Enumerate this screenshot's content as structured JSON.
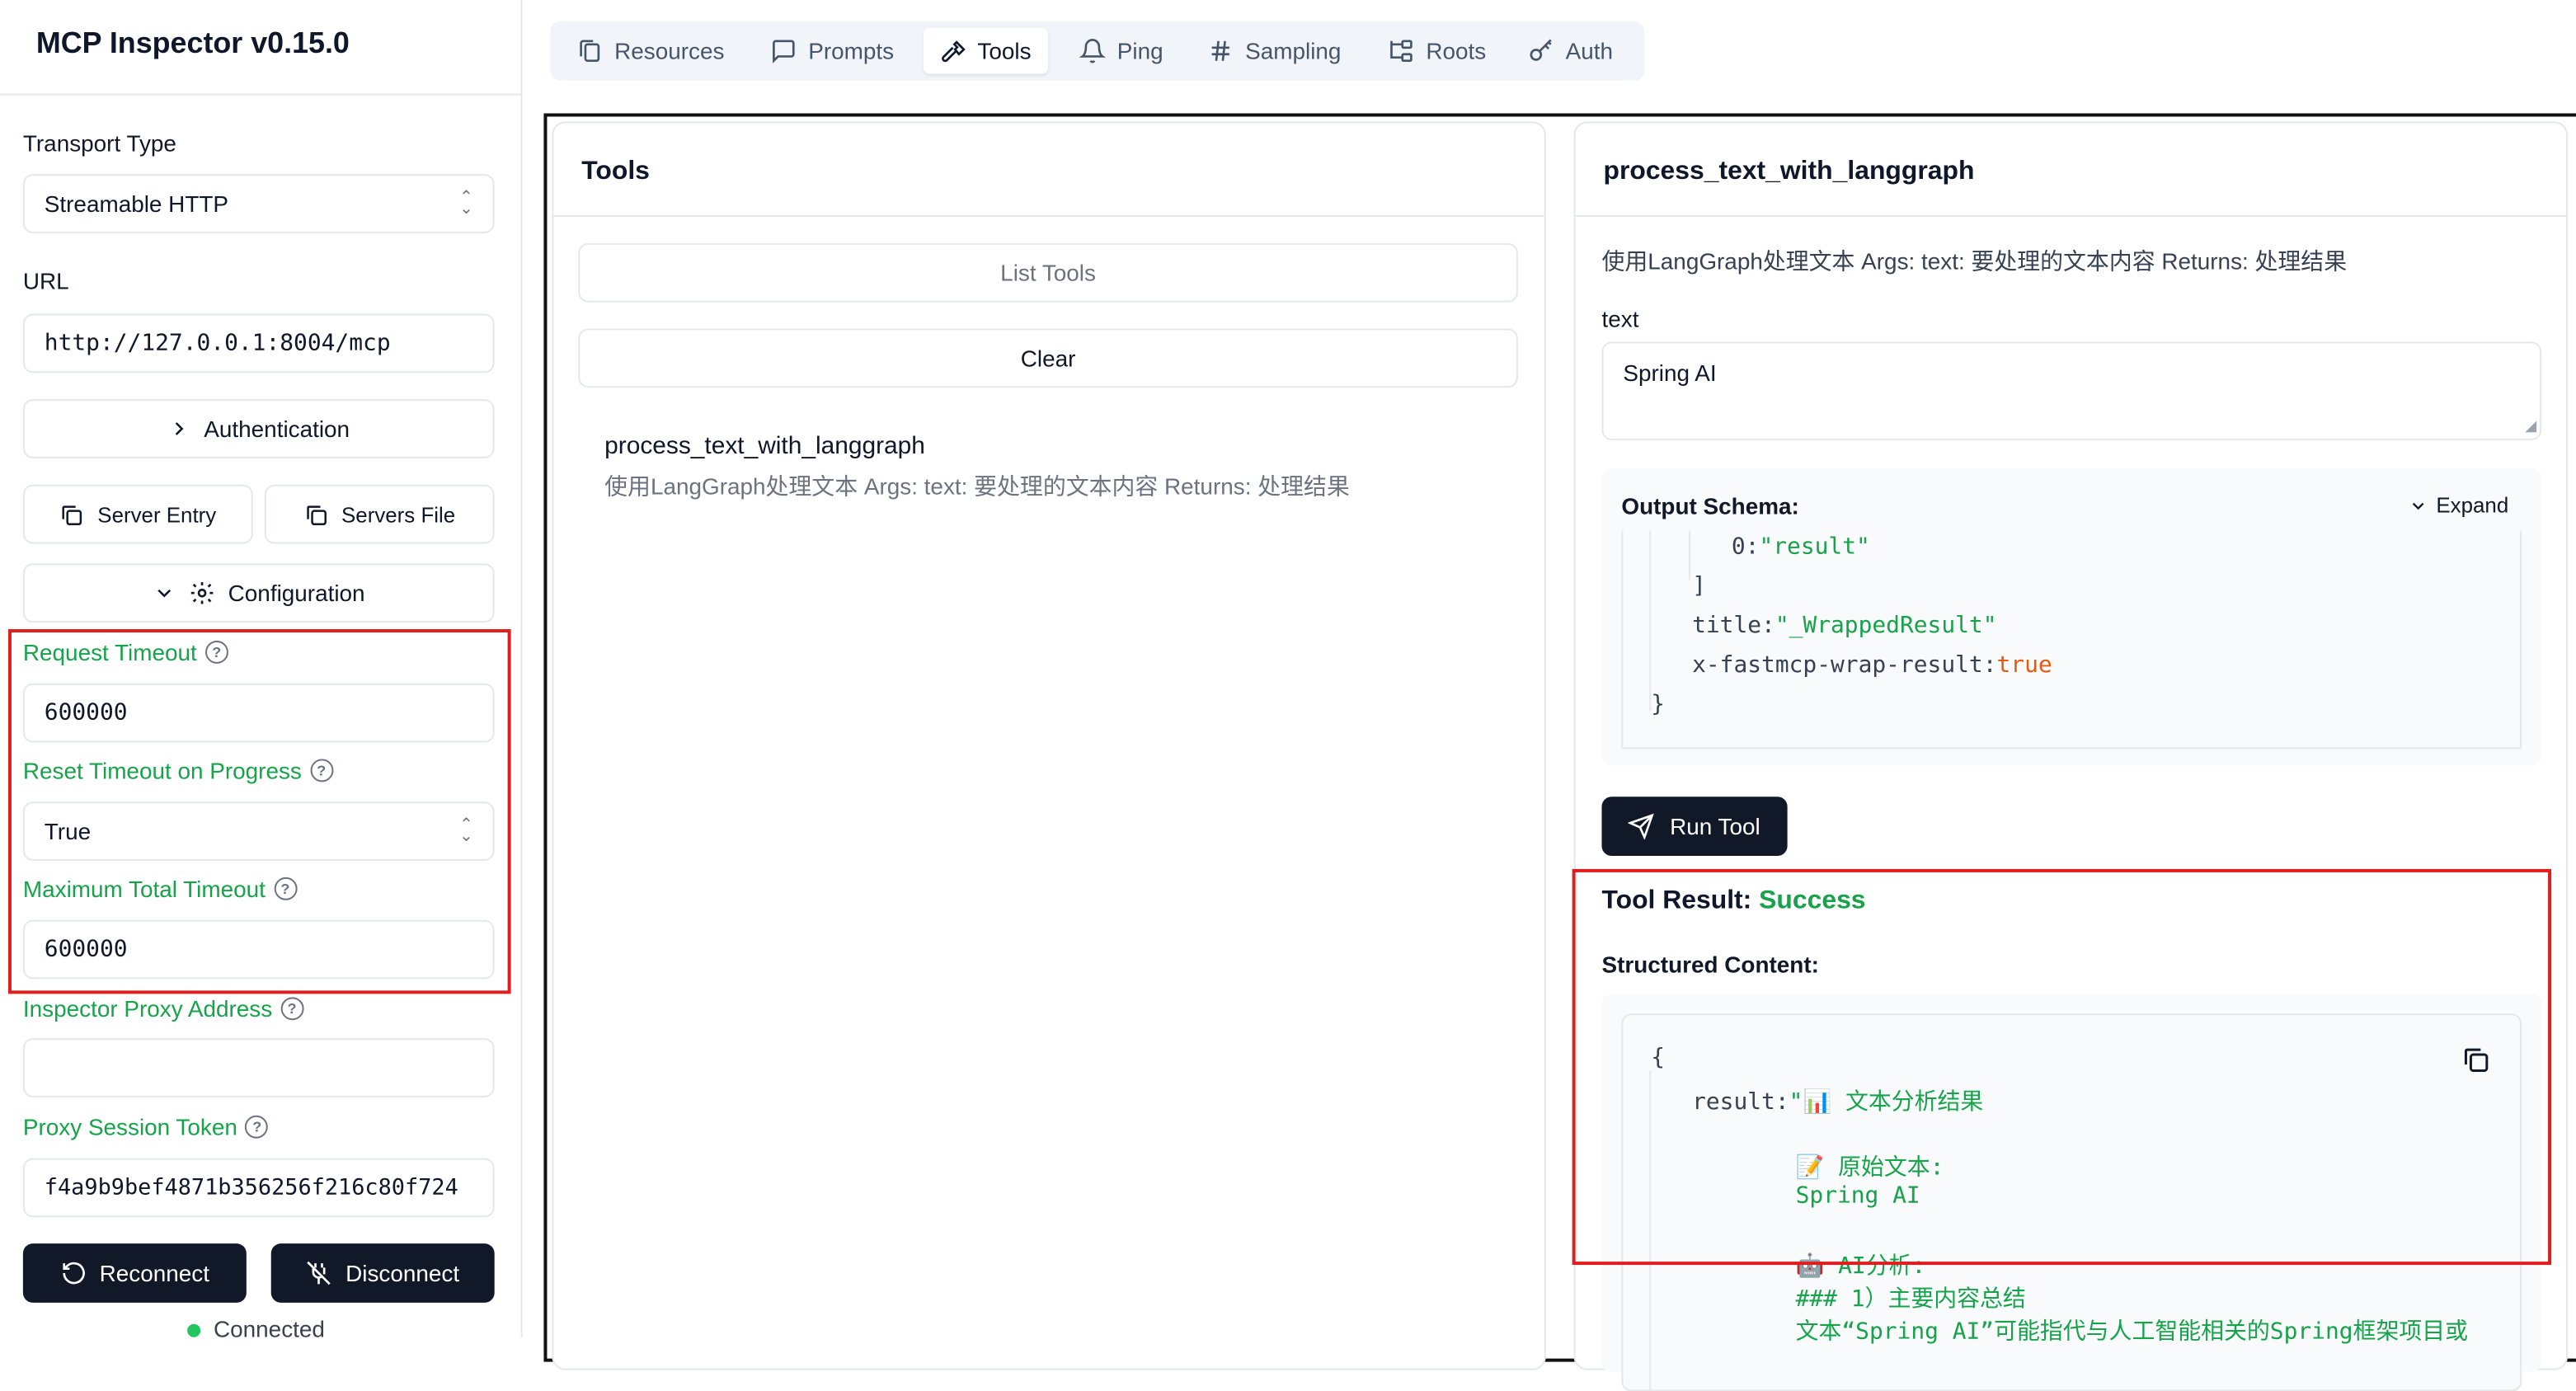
{
  "app": {
    "title": "MCP Inspector v0.15.0"
  },
  "sidebar": {
    "transport_label": "Transport Type",
    "transport_value": "Streamable HTTP",
    "url_label": "URL",
    "url_value": "http://127.0.0.1:8004/mcp",
    "authentication_label": "Authentication",
    "server_entry_label": "Server Entry",
    "servers_file_label": "Servers File",
    "configuration_label": "Configuration",
    "request_timeout_label": "Request Timeout",
    "request_timeout_value": "600000",
    "reset_timeout_label": "Reset Timeout on Progress",
    "reset_timeout_value": "True",
    "max_timeout_label": "Maximum Total Timeout",
    "max_timeout_value": "600000",
    "proxy_address_label": "Inspector Proxy Address",
    "proxy_address_value": "",
    "proxy_token_label": "Proxy Session Token",
    "proxy_token_value": "f4a9b9bef4871b356256f216c80f724",
    "reconnect_label": "Reconnect",
    "disconnect_label": "Disconnect",
    "status_text": "Connected"
  },
  "tabs": [
    {
      "label": "Resources",
      "icon": "files-icon"
    },
    {
      "label": "Prompts",
      "icon": "message-square-icon"
    },
    {
      "label": "Tools",
      "icon": "hammer-icon",
      "active": true
    },
    {
      "label": "Ping",
      "icon": "bell-icon"
    },
    {
      "label": "Sampling",
      "icon": "hash-icon"
    },
    {
      "label": "Roots",
      "icon": "folder-tree-icon"
    },
    {
      "label": "Auth",
      "icon": "key-icon"
    }
  ],
  "tools_panel": {
    "title": "Tools",
    "list_tools_label": "List Tools",
    "clear_label": "Clear",
    "items": [
      {
        "name": "process_text_with_langgraph",
        "description": "使用LangGraph处理文本 Args: text: 要处理的文本内容 Returns: 处理结果"
      }
    ]
  },
  "detail_panel": {
    "title": "process_text_with_langgraph",
    "description": "使用LangGraph处理文本 Args: text: 要处理的文本内容 Returns: 处理结果",
    "param_label": "text",
    "param_value": "Spring AI",
    "output_schema_label": "Output Schema:",
    "expand_label": "Expand",
    "schema_lines": {
      "l1_key": "0:",
      "l1_val": "\"result\"",
      "l2": "]",
      "l3_key": "title:",
      "l3_val": "\"_WrappedResult\"",
      "l4_key": "x-fastmcp-wrap-result:",
      "l4_val": "true",
      "l5": "}"
    },
    "run_tool_label": "Run Tool",
    "result_label": "Tool Result:",
    "result_status": "Success",
    "structured_label": "Structured Content:",
    "result_lines": {
      "open": "{",
      "key": "result:",
      "v1": "\"📊 文本分析结果",
      "v2": "📝 原始文本:",
      "v3": "Spring AI",
      "v4": "🤖 AI分析:",
      "v5": "### 1）主要内容总结",
      "v6": "文本“Spring AI”可能指代与人工智能相关的Spring框架项目或"
    }
  },
  "colors": {
    "accent_green": "#16a34a",
    "highlight_red": "#e11d1d",
    "dark_button": "#111827"
  }
}
